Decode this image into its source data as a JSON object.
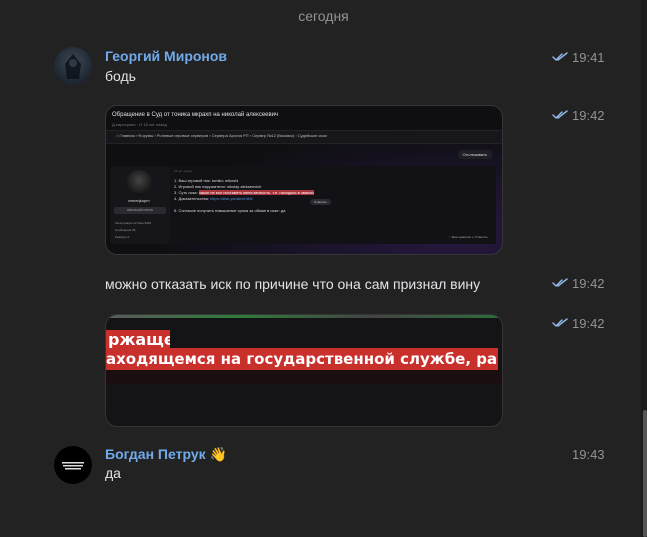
{
  "date_separator": "сегодня",
  "messages": [
    {
      "author": "Георгий Миронов",
      "text": "бодь",
      "time": "19:41",
      "read": true
    },
    {
      "time": "19:42",
      "read": true,
      "screenshot": {
        "title": "Обращение в Суд от тоника мкрахп на николай алексеевич",
        "meta": "Д.еарсериоп · О 16 окт лазад",
        "breadcrumbs": "⌂  Главная  ›  Форумы  ›  Ролевые игровые серверов  ›  Сервера Аргона РП  ›  Сервер №12 (Вязовск)  ›  Судейские иски",
        "follow_label": "Отслеживать",
        "user_name": "zvmeqkupm",
        "user_role": "ОБЫЧНЫЙ ИГРОК",
        "stats": "Регистрация 12 Июн 2020\nСообщения 96\nРеакции 4",
        "post_date": "15 окт лазад",
        "lines": [
          "1. Ваш игровой ник: tomiko mikoshi",
          "2. Игровой ник нарушителя: nikolay alekseevich",
          "3. Суть иска:",
          "4. Доказательства:",
          "5. Согласие получить повышение срока за обман в иске: да"
        ],
        "line3_highlight": "закон не мог поставить меня вечность, т.е. находясь в звании",
        "line4_link": "https://disk.yandex/mkN",
        "reply_label": "Ответить",
        "footer": "♡ Мне нравится   ↩ Ответить"
      }
    },
    {
      "text": "можно отказать иск по причине что она сам признал вину",
      "time": "19:42",
      "read": true
    },
    {
      "time": "19:42",
      "read": true,
      "zoom_image": {
        "line1": "ржащего",
        "line2": "аходящемся на государственной службе, равно как п"
      }
    },
    {
      "author": "Богдан Петрук",
      "author_emoji": "👋",
      "text": "да",
      "time": "19:43",
      "read": false
    }
  ],
  "colors": {
    "author": "#71aaeb",
    "text": "#e1e3e6",
    "time": "#939393",
    "check": "#8db5e6",
    "background": "#222222"
  }
}
